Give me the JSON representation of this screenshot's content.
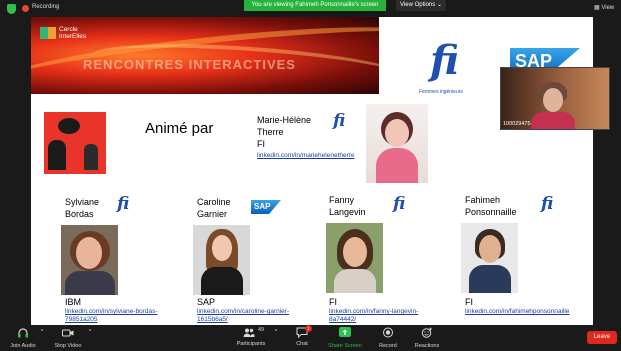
{
  "topbar": {
    "recording_label": "Recording",
    "viewing_text": "You are viewing Fahimeh Ponsonnaille's screen",
    "view_options_label": "View Options",
    "view_label": "View"
  },
  "slide": {
    "banner": {
      "logo_line1": "Cercle",
      "logo_line2": "InterElles",
      "title": "RENCONTRES INTERACTIVES"
    },
    "fi_logo": {
      "letter": "fi",
      "caption": "Femmes ingénieurs"
    },
    "sap_logo": {
      "text": "SAP"
    },
    "moderator": {
      "intro": "Animé par",
      "name_line1": "Marie-Hélène",
      "name_line2": "Therre",
      "org": "FI",
      "link": "linkedin.com/in/mariehelenetherre"
    },
    "panelists": [
      {
        "first": "Sylviane",
        "last": "Bordas",
        "org": "IBM",
        "link_line1": "linkedin.com/in/sylviane-bordas-",
        "link_line2": "79851a205"
      },
      {
        "first": "Caroline",
        "last": "Garnier",
        "org": "SAP",
        "link_line1": "linkedin.com/in/caroline-garnier-",
        "link_line2": "1615b6a5/"
      },
      {
        "first": "Fanny",
        "last": "Langevin",
        "org": "FI",
        "link_line1": "linkedin.com/in/fanny-langevin-",
        "link_line2": "8a74442/"
      },
      {
        "first": "Fahimeh",
        "last": "Ponsonnaille",
        "org": "FI",
        "link_line1": "linkedin.com/in/fahimehponsonnaille",
        "link_line2": ""
      }
    ]
  },
  "self_view": {
    "participant_id": "100029475"
  },
  "toolbar": {
    "join_audio": "Join Audio",
    "stop_video": "Stop Video",
    "participants": "Participants",
    "participants_count": "49",
    "chat": "Chat",
    "chat_badge": "1",
    "share_screen": "Share Screen",
    "record": "Record",
    "reactions": "Reactions",
    "leave": "Leave"
  }
}
